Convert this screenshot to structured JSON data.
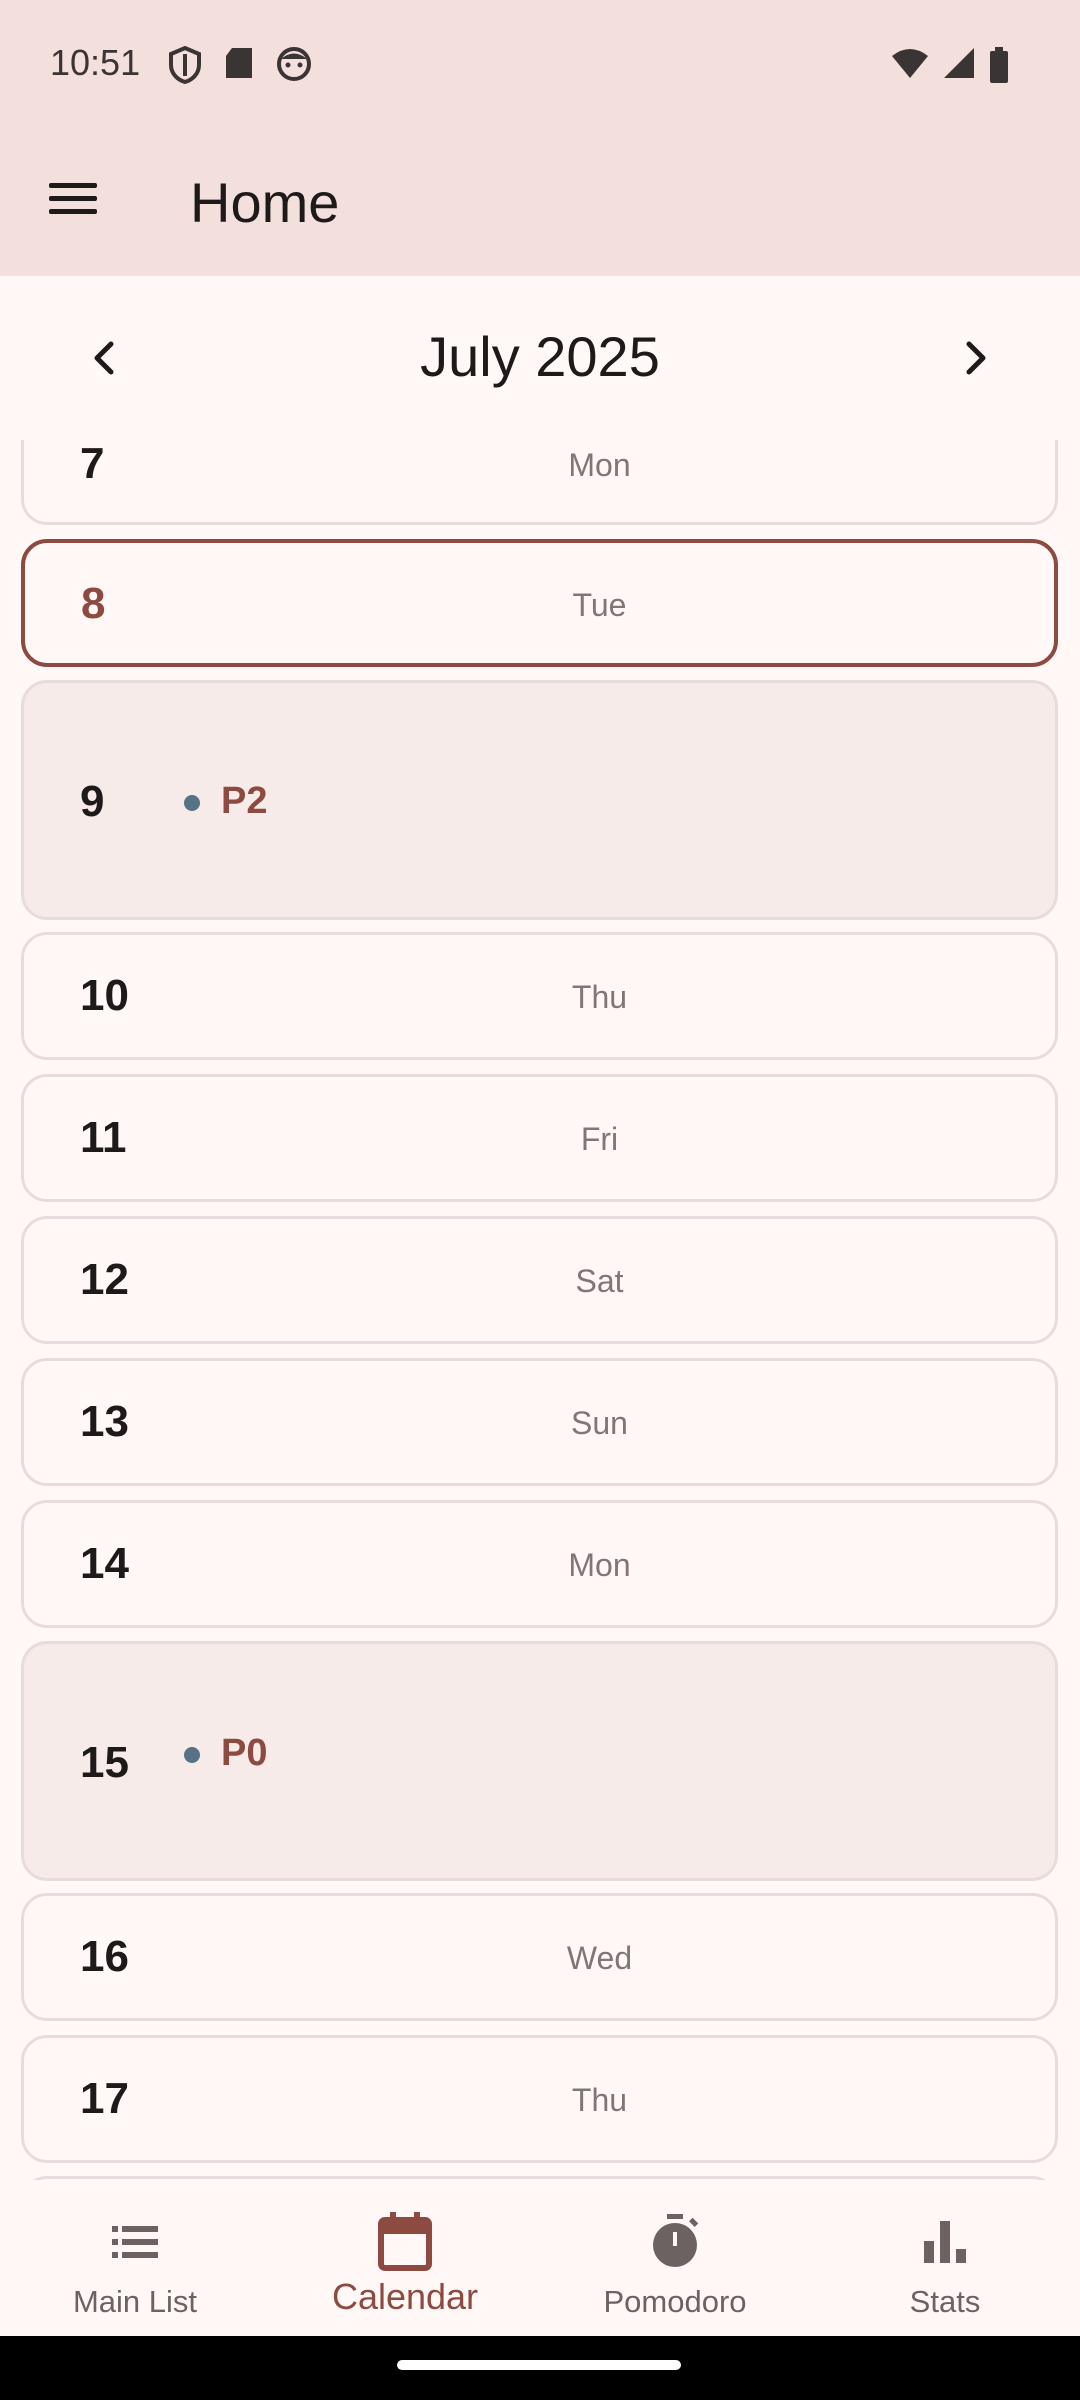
{
  "status_bar": {
    "time": "10:51"
  },
  "app_bar": {
    "title": "Home"
  },
  "calendar": {
    "month_title": "July 2025",
    "days": [
      {
        "num": "7",
        "weekday": "Mon"
      },
      {
        "num": "8",
        "weekday": "Tue",
        "today": true
      },
      {
        "num": "9",
        "event": "P2"
      },
      {
        "num": "10",
        "weekday": "Thu"
      },
      {
        "num": "11",
        "weekday": "Fri"
      },
      {
        "num": "12",
        "weekday": "Sat"
      },
      {
        "num": "13",
        "weekday": "Sun"
      },
      {
        "num": "14",
        "weekday": "Mon"
      },
      {
        "num": "15",
        "event": "P0"
      },
      {
        "num": "16",
        "weekday": "Wed"
      },
      {
        "num": "17",
        "weekday": "Thu"
      }
    ]
  },
  "bottom_nav": {
    "items": [
      {
        "label": "Main List",
        "icon": "list-icon"
      },
      {
        "label": "Calendar",
        "icon": "calendar-icon",
        "active": true
      },
      {
        "label": "Pomodoro",
        "icon": "timer-icon"
      },
      {
        "label": "Stats",
        "icon": "bar-chart-icon"
      }
    ]
  },
  "colors": {
    "accent": "#8c4a40",
    "app_bar_bg": "#f3dfdb",
    "page_bg": "#fff8f7",
    "event_card_bg": "#f6ebe9",
    "event_dot": "#567285"
  }
}
